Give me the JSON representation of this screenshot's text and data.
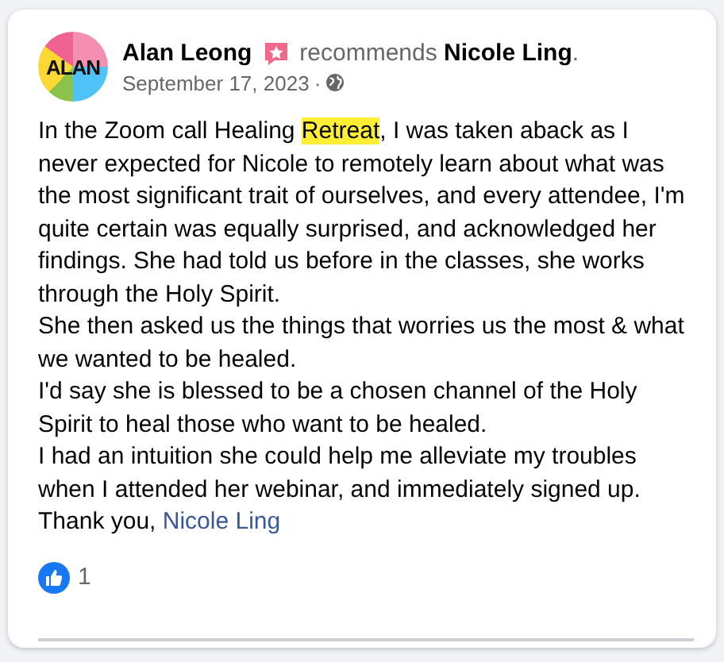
{
  "post": {
    "avatar_text": "ALAN",
    "author": "Alan Leong",
    "action": "recommends",
    "page": "Nicole Ling",
    "page_suffix": ".",
    "date": "September 17, 2023",
    "separator": "·",
    "paragraphs": [
      [
        {
          "kind": "text",
          "text": "In the Zoom call Healing "
        },
        {
          "kind": "highlight",
          "text": "Retreat"
        },
        {
          "kind": "text",
          "text": ", I was taken aback as I never expected for Nicole to remotely learn about what was the most significant trait of ourselves, and every attendee, I'm quite certain was equally surprised, and acknowledged her findings. She had told us before in the classes, she works through the Holy Spirit."
        }
      ],
      [
        {
          "kind": "text",
          "text": "She then asked us the things that worries us the most & what we wanted to be healed."
        }
      ],
      [
        {
          "kind": "text",
          "text": "I'd say she is blessed to be a chosen channel of the Holy Spirit to heal those who want to be healed."
        }
      ],
      [
        {
          "kind": "text",
          "text": "I had an intuition she could help me alleviate my troubles when I attended her webinar, and immediately signed up. Thank you, "
        },
        {
          "kind": "link",
          "text": "Nicole Ling"
        }
      ]
    ],
    "reactions": {
      "count": "1"
    }
  }
}
